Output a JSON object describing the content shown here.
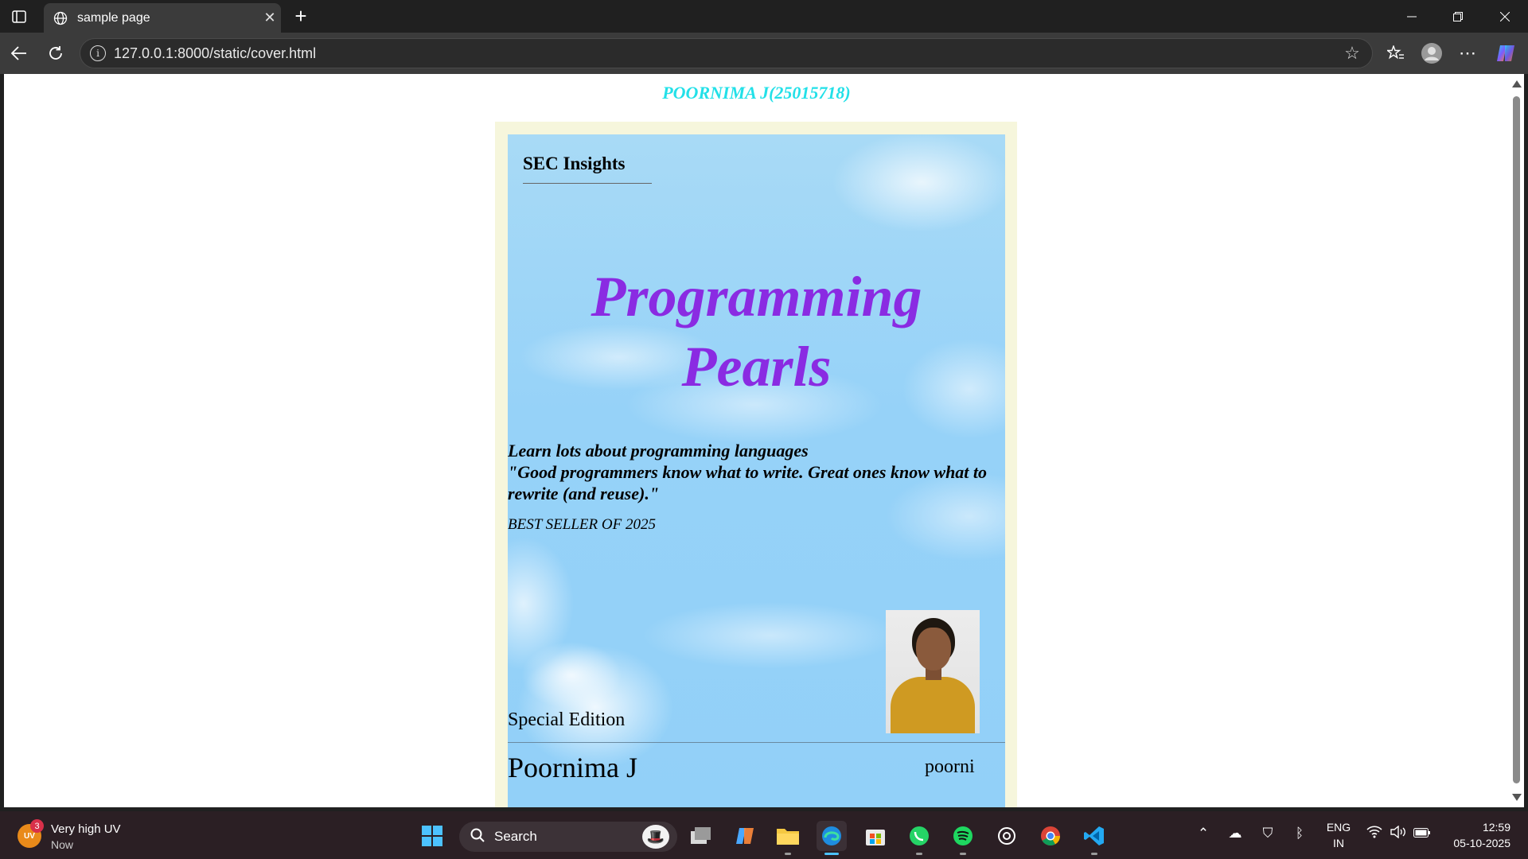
{
  "browser": {
    "tab_title": "sample page",
    "url": "127.0.0.1:8000/static/cover.html"
  },
  "page": {
    "heading": "POORNIMA J(25015718)",
    "cover": {
      "brand": "SEC Insights",
      "title_line1": "Programming",
      "title_line2": "Pearls",
      "tagline_line1": "Learn lots about programming languages",
      "quote": "\"Good programmers know what to write. Great ones know what to rewrite (and reuse).\"",
      "bestseller": "BEST SELLER OF 2025",
      "edition": "Special Edition",
      "author": "Poornima J",
      "nickname": "poorni"
    }
  },
  "taskbar": {
    "weather_title": "Very high UV",
    "weather_time": "Now",
    "weather_badge": "3",
    "weather_icon_text": "UV",
    "search_placeholder": "Search",
    "lang_line1": "ENG",
    "lang_line2": "IN",
    "time": "12:59",
    "date": "05-10-2025"
  },
  "colors": {
    "heading": "#22e0e8",
    "title": "#8a2be2",
    "frame": "#f6f6dc",
    "sky": "#96d2f8"
  }
}
